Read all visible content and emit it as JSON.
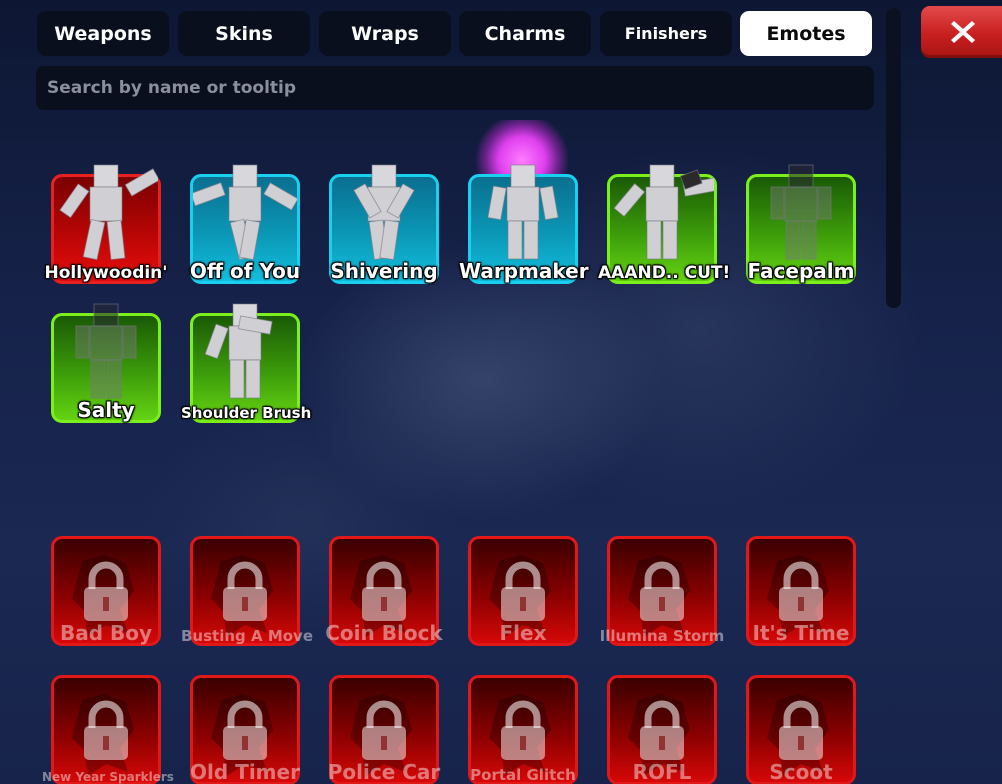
{
  "tabs": [
    {
      "label": "Weapons",
      "active": false
    },
    {
      "label": "Skins",
      "active": false
    },
    {
      "label": "Wraps",
      "active": false
    },
    {
      "label": "Charms",
      "active": false
    },
    {
      "label": "Finishers",
      "active": false
    },
    {
      "label": "Emotes",
      "active": true
    }
  ],
  "close_button": {
    "icon": "close-icon",
    "color": "#d42a2a"
  },
  "search": {
    "placeholder": "Search by name or tooltip",
    "value": ""
  },
  "owned_emotes": [
    {
      "name": "Hollywoodin'",
      "rarity": "red",
      "pose": "point"
    },
    {
      "name": "Off of You",
      "rarity": "blue",
      "pose": "dance"
    },
    {
      "name": "Shivering",
      "rarity": "blue",
      "pose": "crouch"
    },
    {
      "name": "Warpmaker",
      "rarity": "blue",
      "pose": "stand",
      "effect": "magenta-glow"
    },
    {
      "name": "AAAND.. CUT!",
      "rarity": "green",
      "pose": "clapper"
    },
    {
      "name": "Facepalm",
      "rarity": "green",
      "pose": "faded"
    },
    {
      "name": "Salty",
      "rarity": "green",
      "pose": "faded"
    },
    {
      "name": "Shoulder Brush",
      "rarity": "green",
      "pose": "brush"
    }
  ],
  "locked_emotes": [
    {
      "name": "Bad Boy",
      "icon": "lock-icon"
    },
    {
      "name": "Busting A Move",
      "icon": "lock-icon"
    },
    {
      "name": "Coin Block",
      "icon": "lock-icon"
    },
    {
      "name": "Flex",
      "icon": "lock-icon"
    },
    {
      "name": "Illumina Storm",
      "icon": "lock-icon"
    },
    {
      "name": "It's Time",
      "icon": "lock-icon"
    },
    {
      "name": "New Year Sparklers",
      "icon": "lock-icon"
    },
    {
      "name": "Old Timer",
      "icon": "lock-icon"
    },
    {
      "name": "Police Car",
      "icon": "lock-icon"
    },
    {
      "name": "Portal Glitch",
      "icon": "lock-icon"
    },
    {
      "name": "ROFL",
      "icon": "lock-icon"
    },
    {
      "name": "Scoot",
      "icon": "lock-icon"
    }
  ],
  "colors": {
    "locked": "#e01818",
    "red": "#e82020",
    "blue": "#1ad0ef",
    "green": "#7bf01a"
  }
}
